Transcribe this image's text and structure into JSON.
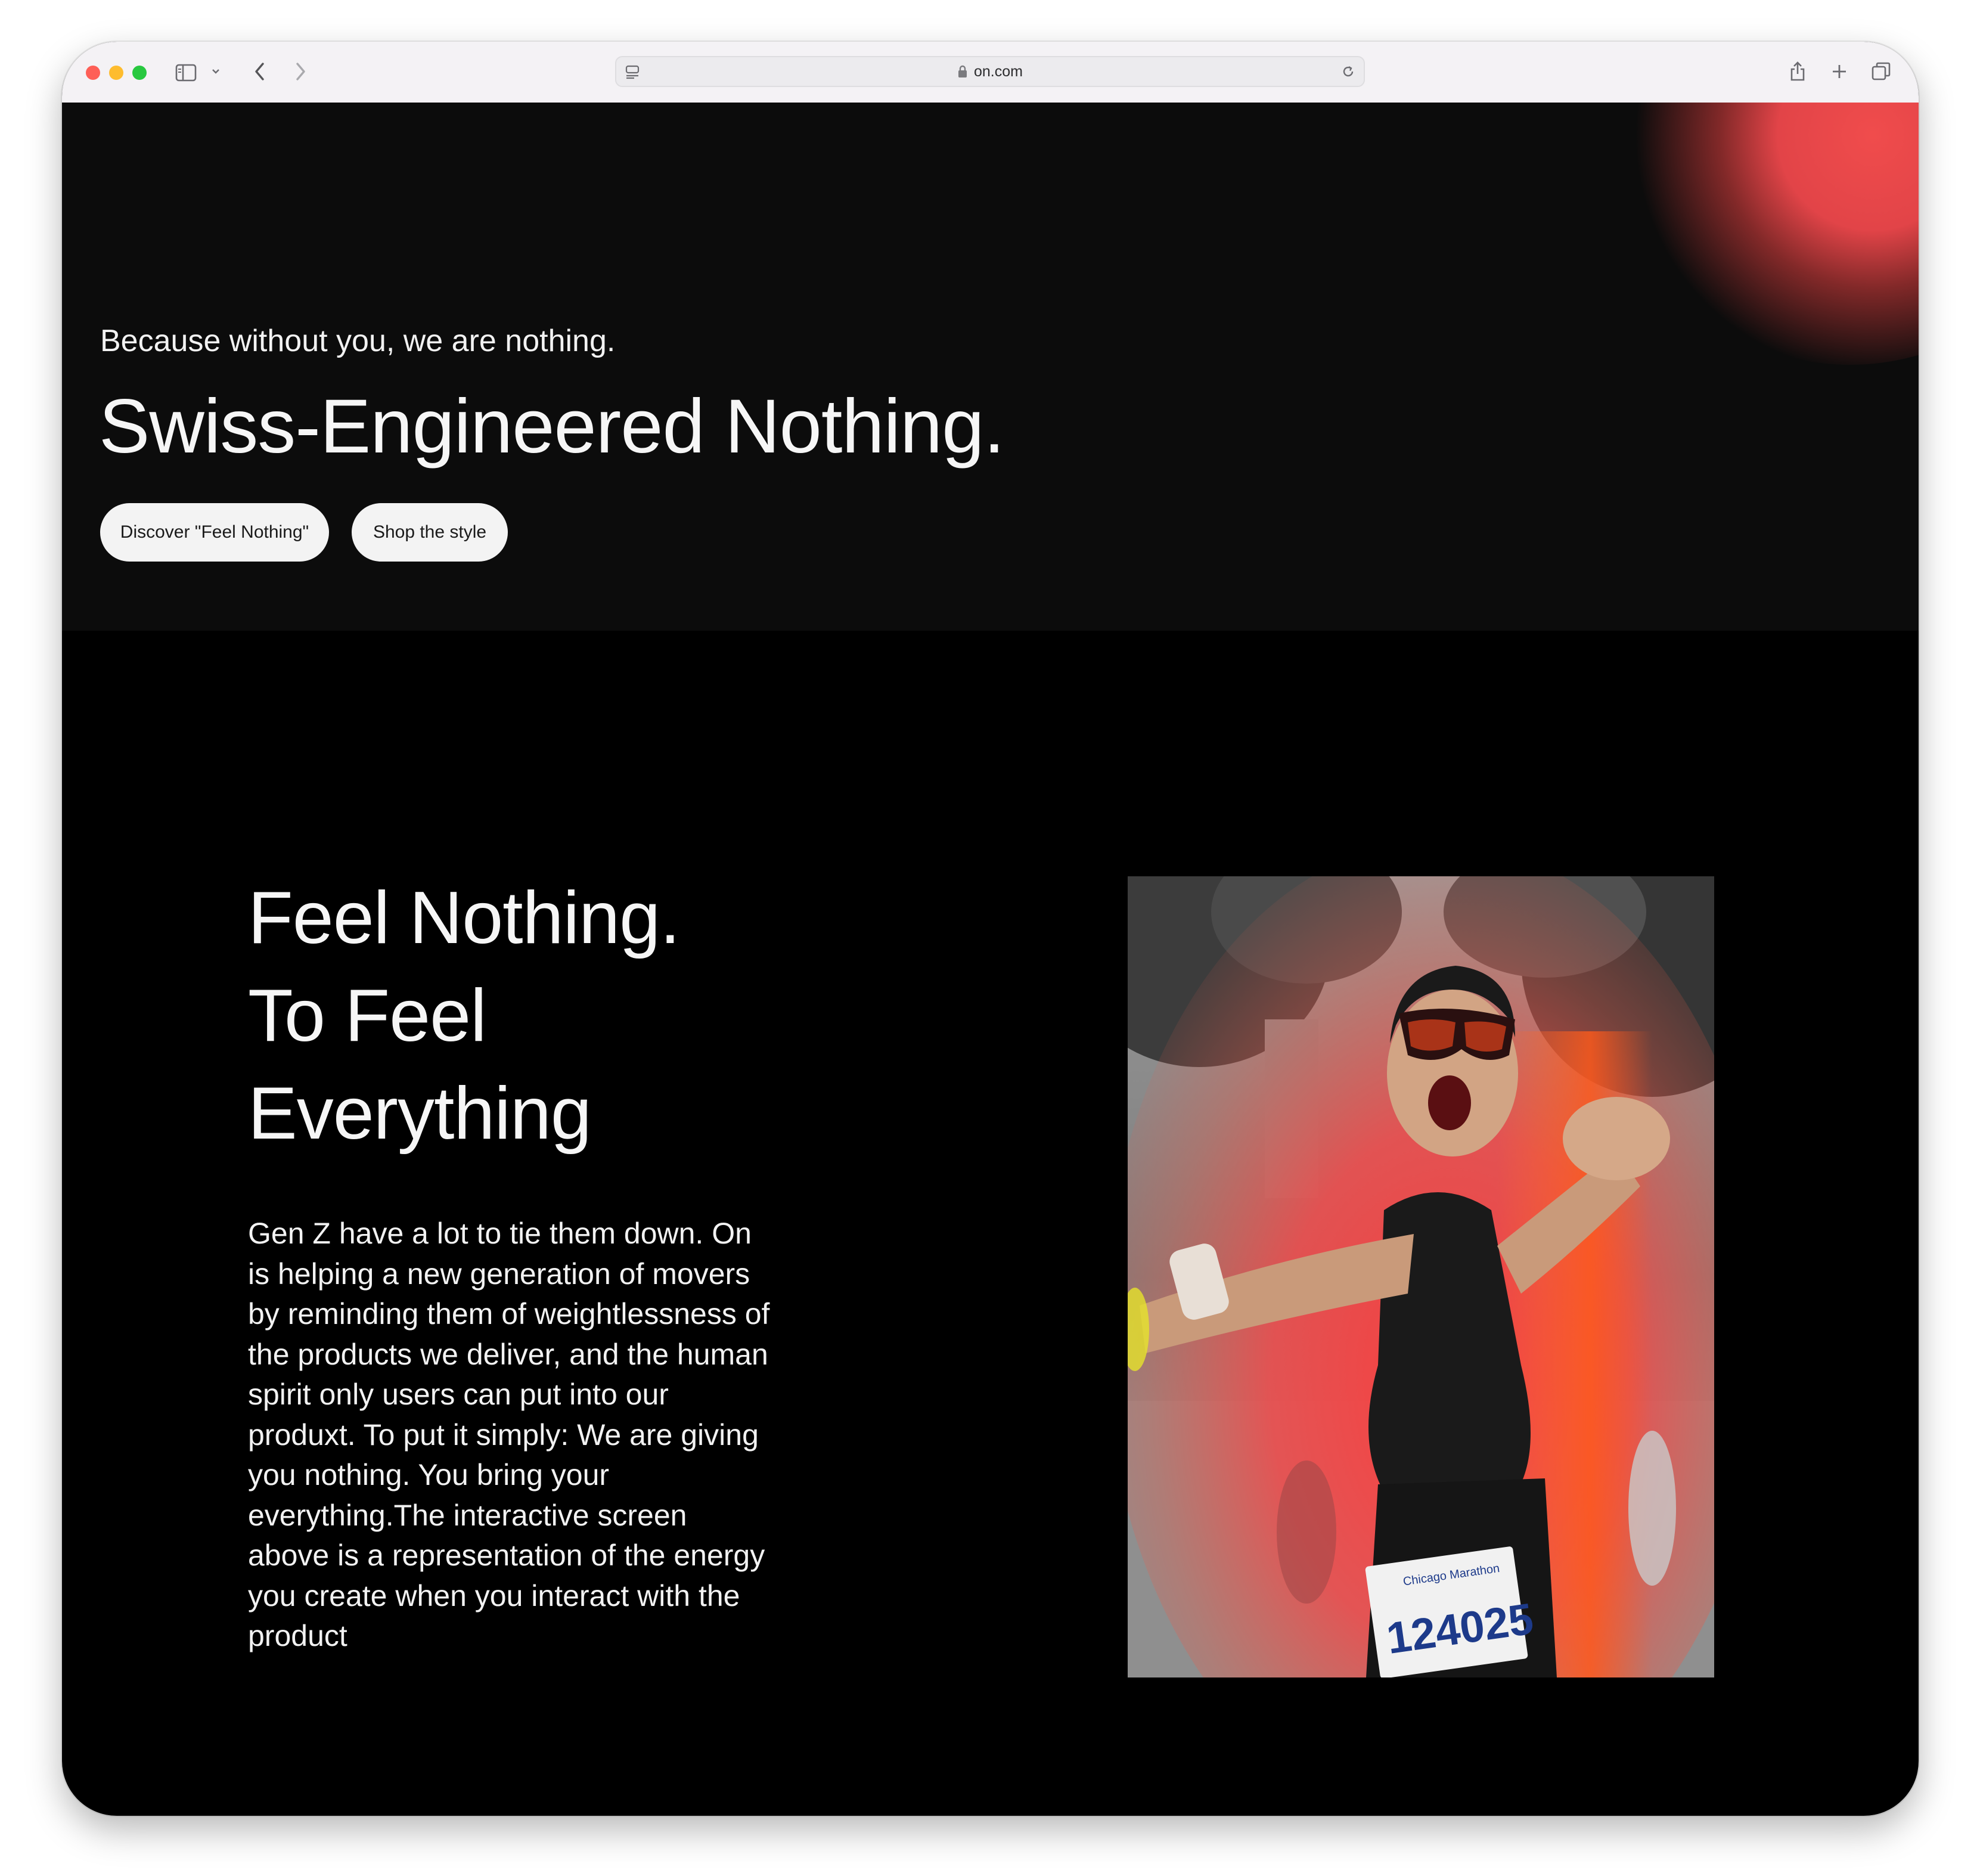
{
  "browser": {
    "url": "on.com",
    "colors": {
      "close": "#fe5f57",
      "minimize": "#febc2e",
      "zoom": "#28c840"
    },
    "icons": [
      "sidebar-icon",
      "chevron-down-icon",
      "back-icon",
      "forward-icon",
      "tab-overview-icon",
      "lock-icon",
      "reload-icon",
      "share-icon",
      "new-tab-icon",
      "tabs-icon"
    ]
  },
  "hero": {
    "subtitle": "Because without you, we are nothing.",
    "title": "Swiss-Engineered Nothing.",
    "buttons": {
      "discover": "Discover \"Feel Nothing\"",
      "shop": "Shop the style"
    },
    "accent_color": "#e64448"
  },
  "feature": {
    "title_lines": [
      "Feel Nothing.",
      "To Feel",
      "Everything"
    ],
    "body": "Gen Z have a lot to tie them down. On is helping a new generation of movers by reminding them of weightlessness of the products we deliver, and the human spirit only users can put into our produxt. To put it simply: We are giving you nothing. You bring your everything.The interactive screen above is a representation of the energy you create when you interact with the product",
    "photo": {
      "bib_label": "Chicago Marathon",
      "bib_number": "124025"
    }
  }
}
